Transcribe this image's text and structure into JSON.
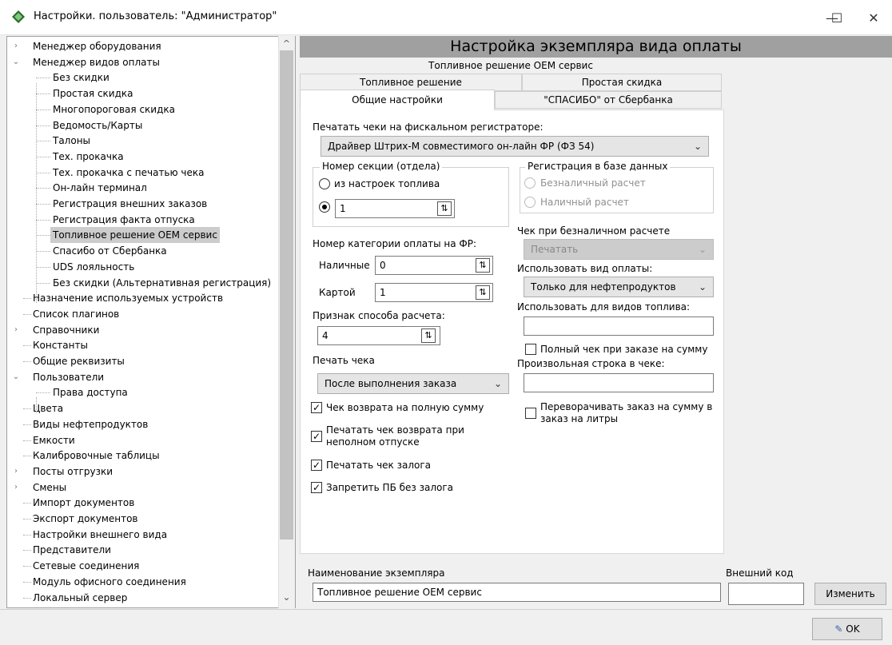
{
  "window": {
    "title": "Настройки. пользователь: \"Администратор\"",
    "minimize": "—",
    "maximize": "☐",
    "close": "✕"
  },
  "tree": {
    "items": [
      {
        "label": "Менеджер оборудования",
        "expander": "›"
      },
      {
        "label": "Менеджер видов оплаты",
        "expander": "⌄"
      },
      {
        "label": "Без скидки"
      },
      {
        "label": "Простая скидка"
      },
      {
        "label": "Многопороговая скидка"
      },
      {
        "label": "Ведомость/Карты"
      },
      {
        "label": "Талоны"
      },
      {
        "label": "Тех. прокачка"
      },
      {
        "label": "Тех. прокачка с печатью чека"
      },
      {
        "label": "Он-лайн терминал"
      },
      {
        "label": "Регистрация внешних заказов"
      },
      {
        "label": "Регистрация факта отпуска"
      },
      {
        "label": "Топливное решение ОЕМ сервис"
      },
      {
        "label": "Спасибо от Сбербанка"
      },
      {
        "label": "UDS лояльность"
      },
      {
        "label": "Без скидки (Альтернативная регистрация)"
      },
      {
        "label": "Назначение используемых устройств"
      },
      {
        "label": "Список плагинов"
      },
      {
        "label": "Справочники",
        "expander": "›"
      },
      {
        "label": "Константы"
      },
      {
        "label": "Общие реквизиты"
      },
      {
        "label": "Пользователи",
        "expander": "⌄"
      },
      {
        "label": "Права доступа"
      },
      {
        "label": "Цвета"
      },
      {
        "label": "Виды нефтепродуктов"
      },
      {
        "label": "Емкости"
      },
      {
        "label": "Калибровочные таблицы"
      },
      {
        "label": "Посты отгрузки",
        "expander": "›"
      },
      {
        "label": "Смены",
        "expander": "›"
      },
      {
        "label": "Импорт документов"
      },
      {
        "label": "Экспорт документов"
      },
      {
        "label": "Настройки внешнего вида"
      },
      {
        "label": "Представители"
      },
      {
        "label": "Сетевые соединения"
      },
      {
        "label": "Модуль офисного соединения"
      },
      {
        "label": "Локальный сервер"
      }
    ],
    "selected": "Топливное решение ОЕМ сервис",
    "scroll_up": "^",
    "scroll_down": "⌄"
  },
  "header": {
    "title": "Настройка экземпляра вида оплаты"
  },
  "tabs": {
    "row1": [
      "Топливное решение ОЕМ сервис"
    ],
    "row2": [
      "Топливное решение",
      "Простая скидка"
    ],
    "row3": [
      "Общие настройки",
      "\"СПАСИБО\" от Сбербанка"
    ],
    "active": "Общие настройки"
  },
  "general": {
    "print_on_fr_label": "Печатать чеки на фискальном регистраторе:",
    "print_on_fr_value": "Драйвер Штрих-М совместимого он-лайн ФР (ФЗ 54)",
    "section_group_title": "Номер секции (отдела)",
    "section_from_fuel": "из настроек топлива",
    "section_value": "1",
    "db_group_title": "Регистрация в базе данных",
    "db_cashless": "Безналичный расчет",
    "db_cash": "Наличный расчет",
    "category_label": "Номер категории оплаты на ФР:",
    "cash_label": "Наличные",
    "cash_value": "0",
    "card_label": "Картой",
    "card_value": "1",
    "calc_method_label": "Признак способа расчета:",
    "calc_method_value": "4",
    "print_receipt_label": "Печать чека",
    "print_receipt_value": "После выполнения заказа",
    "cb_full_return": "Чек возврата на полную сумму",
    "cb_partial_return": "Печатать чек возврата при неполном отпуске",
    "cb_deposit": "Печатать чек залога",
    "cb_no_pb": "Запретить ПБ без залога",
    "cashless_receipt_label": "Чек при безналичном расчете",
    "cashless_receipt_value": "Печатать",
    "use_payment_label": "Использовать вид оплаты:",
    "use_payment_value": "Только для нефтепродуктов",
    "fuel_types_label": "Использовать для видов топлива:",
    "fuel_types_value": "",
    "cb_full_on_sum": "Полный чек при заказе на сумму",
    "custom_line_label": "Произвольная строка в чеке:",
    "custom_line_value": "",
    "cb_flip_order": "Переворачивать заказ на сумму в заказ на литры"
  },
  "bottom": {
    "name_label": "Наименование экземпляра",
    "name_value": "Топливное решение ОЕМ сервис",
    "ext_code_label": "Внешний код",
    "ext_code_value": "",
    "change_button": "Изменить",
    "ok_button": "OK",
    "check_mark": "✓",
    "spin_glyph": "⇅"
  }
}
